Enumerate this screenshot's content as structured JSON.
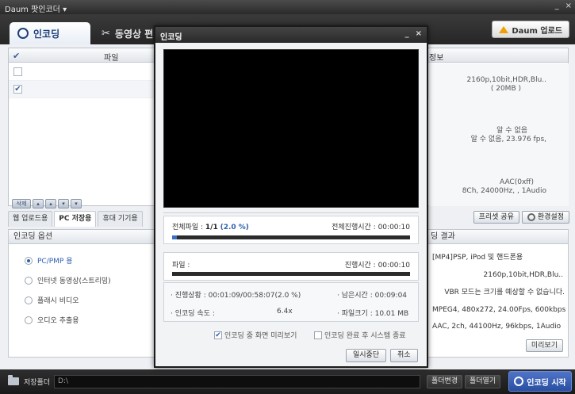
{
  "window": {
    "title": "Daum 팟인코더 ▾",
    "min": "_",
    "close": "×"
  },
  "main_tabs": [
    {
      "label": "인코딩",
      "active": true,
      "icon": "encode-icon"
    },
    {
      "label": "동영상 편",
      "active": false,
      "icon": "scissors-icon"
    }
  ],
  "daum_update": "Daum 업로드",
  "file_list": {
    "header_check": "✔",
    "header_file": "파일",
    "header_info": "정보",
    "rows": [
      {
        "checked": false
      },
      {
        "checked": true
      }
    ],
    "info_lines": [
      "2160p,10bit,HDR,Blu..",
      "( 20MB )",
      "알 수 없음",
      "알 수 없음, 23.976 fps,",
      "AAC(0xff)",
      "8Ch, 24000Hz, , 1Audio"
    ]
  },
  "list_tools": [
    "삭제",
    "▴",
    "▴",
    "▾",
    "▾"
  ],
  "sub_tabs": [
    {
      "label": "웹 업로드용",
      "active": false
    },
    {
      "label": "PC 저장용",
      "active": true
    },
    {
      "label": "휴대 기기용",
      "active": false
    }
  ],
  "preset_share": "프리셋 공유",
  "settings": "환경설정",
  "options": {
    "title": "인코딩 옵션",
    "items": [
      {
        "label": "PC/PMP 용",
        "selected": true
      },
      {
        "label": "인터넷 동영상(스트리밍)",
        "selected": false
      },
      {
        "label": "플래시 비디오",
        "selected": false
      },
      {
        "label": "오디오 추출용",
        "selected": false
      }
    ]
  },
  "result": {
    "title": "딩 결과",
    "lines": [
      "[MP4]PSP, iPod 및 핸드폰용",
      "2160p,10bit,HDR,Blu..",
      "VBR 모드는 크기를 예상할 수 없습니다.",
      "MPEG4, 480x272, 24.00Fps, 600kbps",
      "AAC, 2ch, 44100Hz, 96kbps, 1Audio"
    ],
    "preview": "미리보기"
  },
  "bottom": {
    "save_folder_label": "저장폴더",
    "path": "D:\\",
    "change_folder": "폴더변경",
    "open_folder": "폴더열기",
    "start": "인코딩 시작"
  },
  "dialog": {
    "title": "인코딩",
    "min": "_",
    "close": "×",
    "total_files_label": "전체파일 :",
    "total_files_value": "1/1",
    "total_percent": "(2.0 %)",
    "total_progress": 0.02,
    "total_time_label": "전체진행시간 :",
    "total_time": "00:00:10",
    "file_label": "파일 :",
    "file_time_label": "진행시간 :",
    "file_time": "00:00:10",
    "file_progress": 0.0,
    "progress_status": "· 진행상황 : 00:01:09/00:58:07(2.0 %)",
    "remaining": "· 남은시간 : 00:09:04",
    "speed_label": "· 인코딩 속도 :",
    "speed": "6.4x",
    "filesize": "· 파일크기 : 10.01 MB",
    "preview_check": {
      "label": "인코딩 중 화면 미리보기",
      "checked": true
    },
    "shutdown_check": {
      "label": "인코딩 완료 후 시스템 종료",
      "checked": false
    },
    "pause_button": "일시중단",
    "cancel_button": "취소"
  }
}
